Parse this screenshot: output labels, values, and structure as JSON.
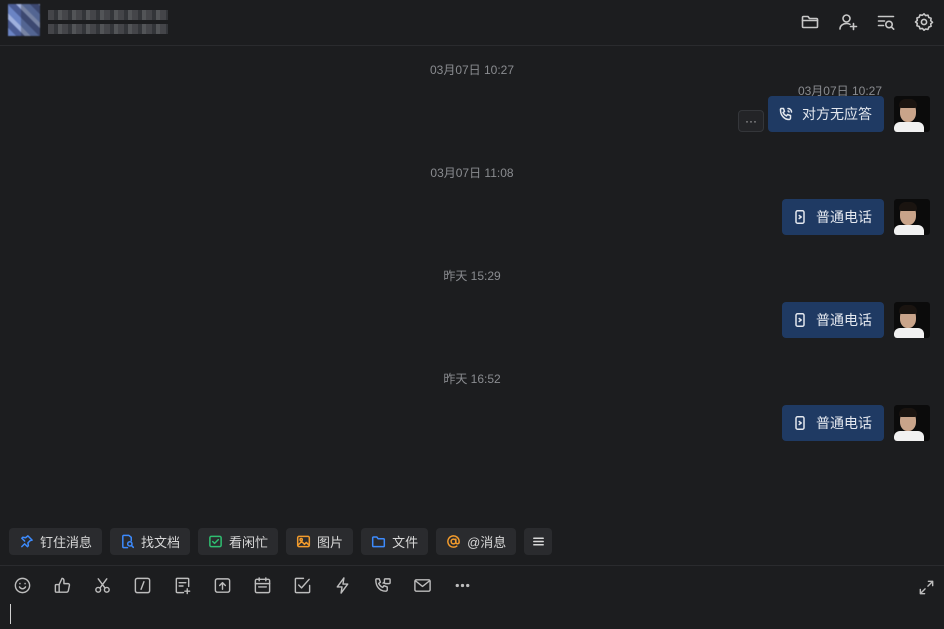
{
  "header": {
    "actions": [
      {
        "name": "folder-icon",
        "label": "文件"
      },
      {
        "name": "add-user-icon",
        "label": "添加成员"
      },
      {
        "name": "search-history-icon",
        "label": "搜索"
      },
      {
        "name": "gear-icon",
        "label": "设置"
      }
    ]
  },
  "messages": [
    {
      "timestamp": "03月07日 10:27",
      "inline_time": "03月07日 10:27",
      "text": "对方无应答",
      "icon": "phone-call-icon"
    },
    {
      "timestamp": "03月07日 11:08",
      "text": "普通电话",
      "icon": "phone-icon"
    },
    {
      "timestamp": "昨天 15:29",
      "text": "普通电话",
      "icon": "phone-icon"
    },
    {
      "timestamp": "昨天 16:52",
      "text": "普通电话",
      "icon": "phone-icon"
    }
  ],
  "more_label": "···",
  "chips": [
    {
      "label": "钉住消息",
      "icon": "pin-icon",
      "color": "#3d8bfd"
    },
    {
      "label": "找文档",
      "icon": "doc-search-icon",
      "color": "#3d8bfd"
    },
    {
      "label": "看闲忙",
      "icon": "calendar-check-icon",
      "color": "#2fbf71"
    },
    {
      "label": "图片",
      "icon": "image-icon",
      "color": "#f29b2c"
    },
    {
      "label": "文件",
      "icon": "folder-icon",
      "color": "#3d8bfd"
    },
    {
      "label": "@消息",
      "icon": "at-icon",
      "color": "#f29b2c"
    }
  ],
  "toolbar": [
    "emoji-icon",
    "thumbs-up-icon",
    "scissors-icon",
    "command-icon",
    "note-add-icon",
    "upload-icon",
    "calendar-icon",
    "task-check-icon",
    "lightning-icon",
    "phone-call-icon",
    "mail-icon",
    "more-icon"
  ]
}
